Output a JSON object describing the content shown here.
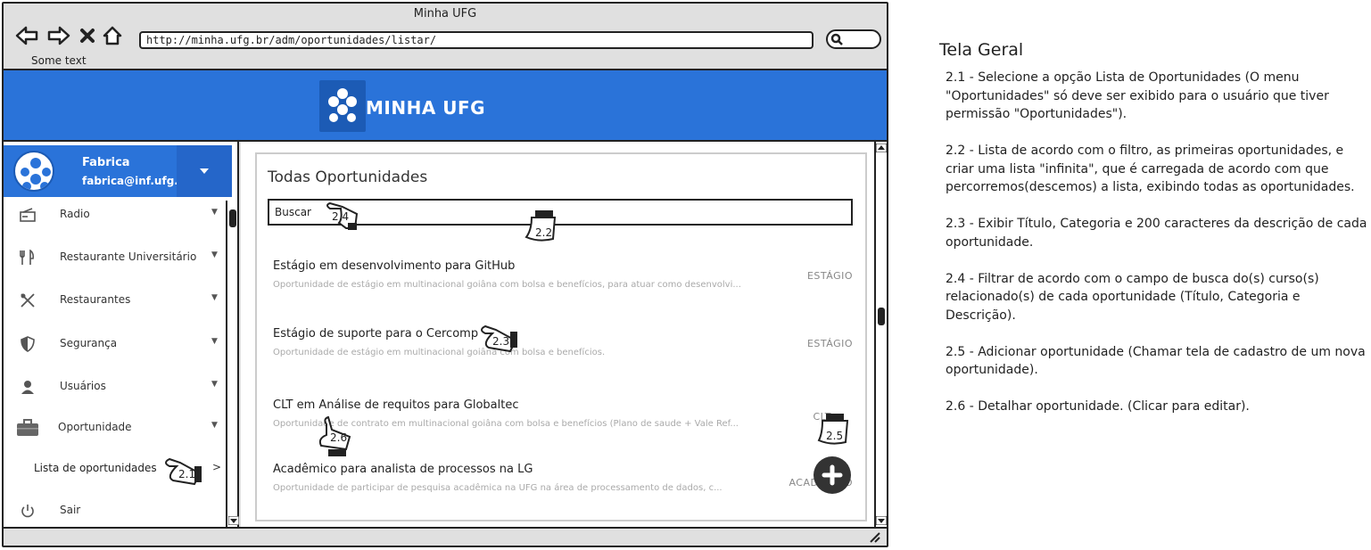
{
  "window": {
    "title": "Minha UFG",
    "url": "http://minha.ufg.br/adm/oportunidades/listar/",
    "some_text": "Some text"
  },
  "header": {
    "brand": "MINHA UFG"
  },
  "user": {
    "name": "Fabrica",
    "email": "fabrica@inf.ufg.br"
  },
  "sidebar": {
    "items": [
      {
        "label": "Radio",
        "icon": "radio-icon"
      },
      {
        "label": "Restaurante Universitário",
        "icon": "fork-knife-icon"
      },
      {
        "label": "Restaurantes",
        "icon": "utensils-cross-icon"
      },
      {
        "label": "Segurança",
        "icon": "shield-icon"
      },
      {
        "label": "Usuários",
        "icon": "user-icon"
      },
      {
        "label": "Oportunidade",
        "icon": "briefcase-icon"
      }
    ],
    "sub_item": "Lista de oportunidades",
    "logout": "Sair"
  },
  "main": {
    "title": "Todas Oportunidades",
    "search_placeholder": "Buscar",
    "opportunities": [
      {
        "title": "Estágio em desenvolvimento para GitHub",
        "desc": "Oportunidade de estágio em multinacional goiâna com bolsa e benefícios, para atuar como desenvolvi...",
        "category": "ESTÁGIO"
      },
      {
        "title": "Estágio de suporte para o Cercomp",
        "desc": "Oportunidade de estágio em multinacional goiâna com bolsa e benefícios.",
        "category": "ESTÁGIO"
      },
      {
        "title": "CLT em Análise de requitos para Globaltec",
        "desc": "Oportunidade de contrato em multinacional goiâna com bolsa e benefícios (Plano de saude + Vale Ref...",
        "category": "CLT"
      },
      {
        "title": "Acadêmico para analista de processos na LG",
        "desc": "Oportunidade de participar de pesquisa acadêmica na UFG na área de processamento de dados, c...",
        "category": "ACADÊMICO"
      }
    ]
  },
  "markers": [
    "2.1",
    "2.2",
    "2.3",
    "2.4",
    "2.5",
    "2.6"
  ],
  "notes": {
    "heading": "Tela Geral",
    "paragraphs": [
      "2.1 - Selecione a opção Lista de Oportunidades (O menu \"Oportunidades\" só deve ser exibido para o usuário que tiver permissão \"Oportunidades\").",
      "2.2 - Lista de acordo com o filtro, as primeiras oportunidades, e criar uma lista \"infinita\", que é carregada de acordo com que percorremos(descemos) a lista, exibindo todas as oportunidades.",
      "2.3 - Exibir Título, Categoria e 200 caracteres da descrição de cada oportunidade.",
      "2.4 - Filtrar de acordo com o campo de busca do(s) curso(s) relacionado(s) de cada oportunidade (Título, Categoria e Descrição).",
      "2.5 - Adicionar oportunidade (Chamar tela de cadastro de um nova oportunidade).",
      "2.6 - Detalhar oportunidade. (Clicar para editar)."
    ]
  }
}
